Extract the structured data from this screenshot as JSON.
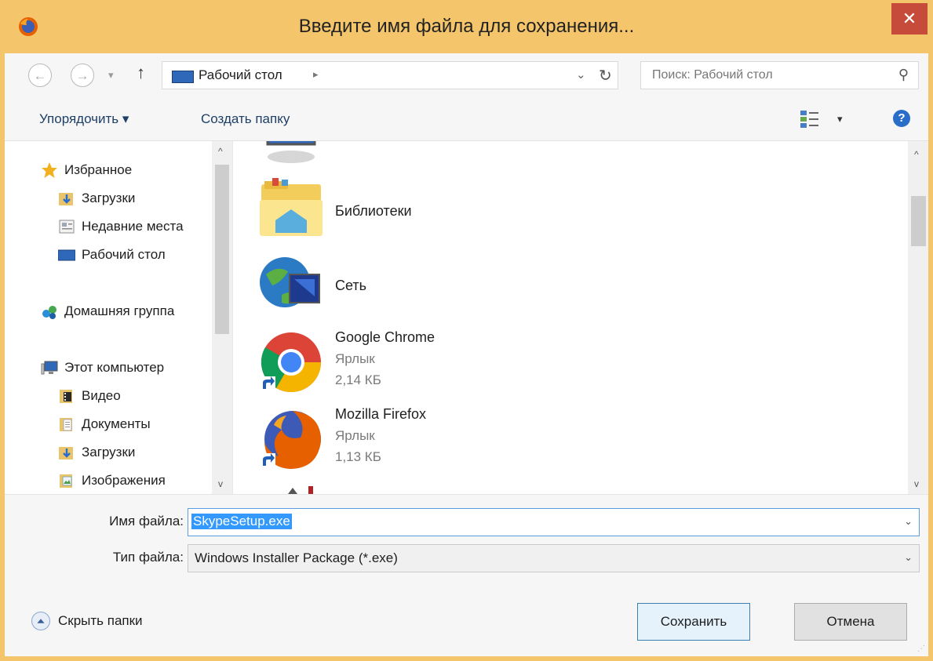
{
  "window": {
    "title": "Введите имя файла для сохранения...",
    "close_glyph": "✕",
    "app_icon": "firefox-icon"
  },
  "nav": {
    "back_glyph": "←",
    "forward_glyph": "→",
    "recent_glyph": "▾",
    "up_glyph": "↑",
    "address": "Рабочий стол",
    "address_sep": "▸",
    "address_dropdown": "⌄",
    "refresh_glyph": "↻",
    "search_placeholder": "Поиск: Рабочий стол",
    "search_glyph": "⚲"
  },
  "toolbar": {
    "organize": "Упорядочить ▾",
    "new_folder": "Создать папку",
    "view_dropdown": "▾",
    "help_glyph": "?"
  },
  "sidebar": {
    "items": [
      {
        "label": "Избранное",
        "icon": "star-icon"
      },
      {
        "label": "Загрузки",
        "icon": "downloads-folder-icon"
      },
      {
        "label": "Недавние места",
        "icon": "recent-places-icon"
      },
      {
        "label": "Рабочий стол",
        "icon": "desktop-icon"
      },
      {
        "label": "Домашняя группа",
        "icon": "homegroup-icon"
      },
      {
        "label": "Этот компьютер",
        "icon": "computer-icon"
      },
      {
        "label": "Видео",
        "icon": "video-folder-icon"
      },
      {
        "label": "Документы",
        "icon": "documents-folder-icon"
      },
      {
        "label": "Загрузки",
        "icon": "downloads-folder-icon"
      },
      {
        "label": "Изображения",
        "icon": "pictures-folder-icon"
      }
    ],
    "scroll_up": "^",
    "scroll_down": "v"
  },
  "files": {
    "items": [
      {
        "name": "Библиотеки",
        "type": "",
        "size": "",
        "icon": "libraries-icon"
      },
      {
        "name": "Сеть",
        "type": "",
        "size": "",
        "icon": "network-icon"
      },
      {
        "name": "Google Chrome",
        "type": "Ярлык",
        "size": "2,14 КБ",
        "icon": "chrome-icon"
      },
      {
        "name": "Mozilla Firefox",
        "type": "Ярлык",
        "size": "1,13 КБ",
        "icon": "firefox-icon"
      }
    ],
    "scroll_up": "^",
    "scroll_down": "v"
  },
  "form": {
    "filename_label": "Имя файла:",
    "filename_value": "SkypeSetup.exe",
    "filetype_label": "Тип файла:",
    "filetype_value": "Windows Installer Package (*.exe)",
    "dropdown_glyph": "⌄",
    "hide_folders": "Скрыть папки",
    "save": "Сохранить",
    "cancel": "Отмена"
  },
  "colors": {
    "titlebar": "#f4c56a",
    "close": "#c74b3b",
    "selection": "#3399ff",
    "link": "#1e3f66"
  }
}
